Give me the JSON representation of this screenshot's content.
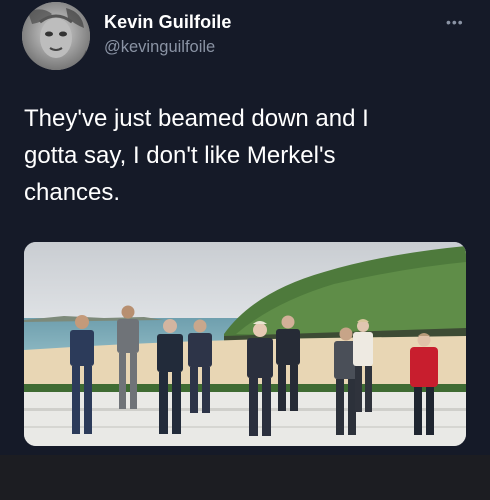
{
  "tweet": {
    "display_name": "Kevin Guilfoile",
    "handle": "@kevinguilfoile",
    "text_lines": [
      "They've just beamed down and I",
      "gotta say, I don't like Merkel's",
      "chances."
    ],
    "more_glyph": "•••"
  },
  "colors": {
    "background": "#151a28",
    "name": "#ffffff",
    "handle": "#8a93a4",
    "footer": "#1c1d22",
    "merkel_jacket": "#c81e2e"
  },
  "icons": {
    "more": "more-horizontal-icon",
    "avatar": "avatar-photo"
  }
}
